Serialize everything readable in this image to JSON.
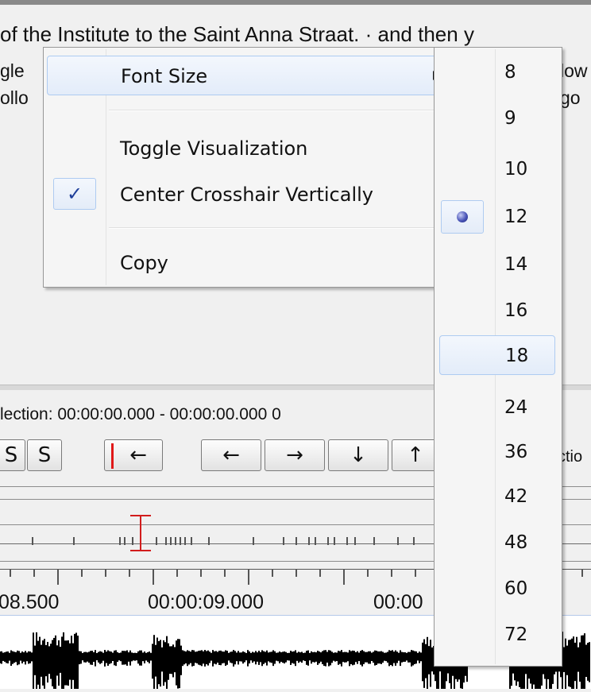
{
  "background": {
    "text_lines": [
      "of the Institute to the Saint Anna Straat.  ·  and then y",
      "gle",
      "ollo"
    ],
    "text_fragments_right": [
      "low",
      "go"
    ],
    "selection_label": "lection: 00:00:00.000 - 00:00:00.000  0",
    "toolbar_buttons": [
      "S",
      "S",
      "←",
      "←",
      "→",
      "↓",
      "↑"
    ],
    "toolbar_partial_label": "ctio",
    "time_labels": [
      "08.500",
      "00:00:09.000",
      "00:00"
    ]
  },
  "context_menu": {
    "items": [
      {
        "label": "Font Size",
        "has_submenu": true
      },
      {
        "label": "Toggle Visualization"
      },
      {
        "label": "Center Crosshair Vertically",
        "checked": true,
        "check_glyph": "✓"
      },
      {
        "label": "Copy"
      }
    ]
  },
  "font_size_submenu": {
    "sizes": [
      "8",
      "9",
      "10",
      "12",
      "14",
      "16",
      "18",
      "24",
      "36",
      "42",
      "48",
      "60",
      "72"
    ],
    "selected": "12",
    "hovered": "18"
  }
}
